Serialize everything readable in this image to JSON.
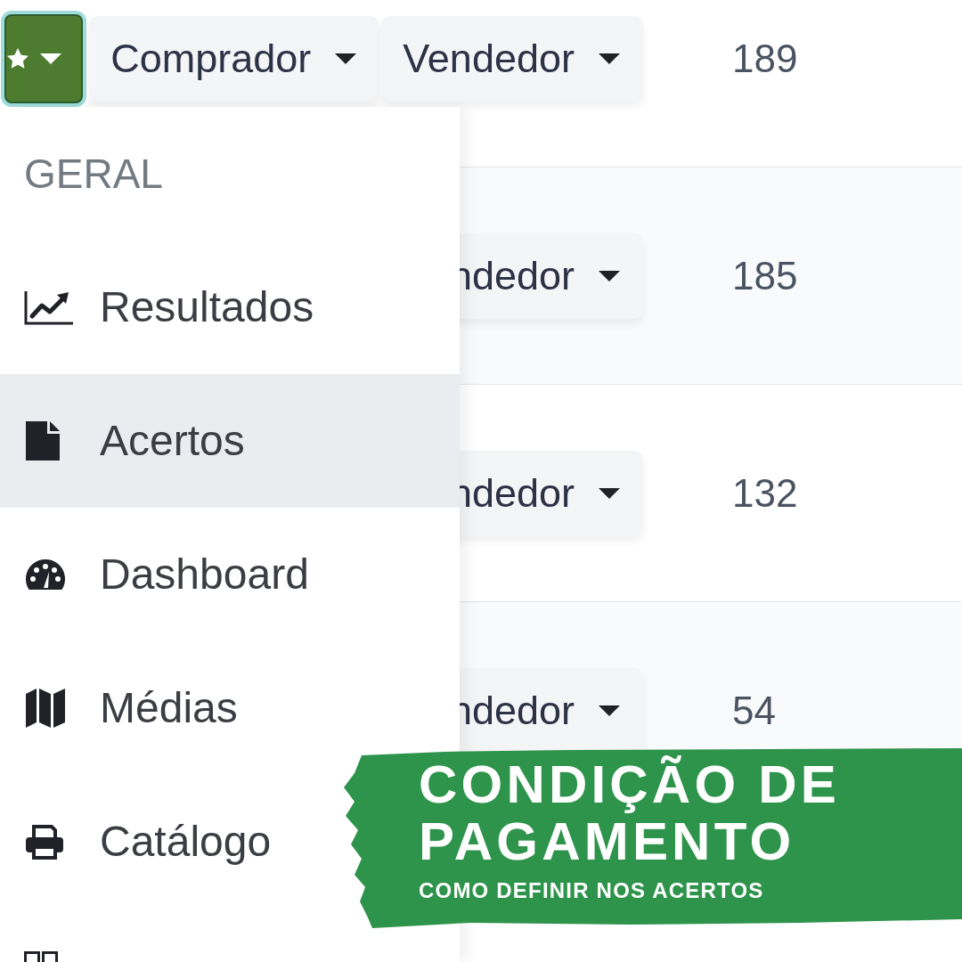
{
  "table": {
    "rows": [
      {
        "actions": [
          {
            "kind": "icon_menu",
            "focused": true
          },
          {
            "kind": "dropdown",
            "label": "Comprador",
            "focused": false
          },
          {
            "kind": "dropdown",
            "label": "Vendedor",
            "focused": false
          }
        ],
        "count": "189"
      },
      {
        "actions": [
          {
            "kind": "dropdown",
            "label": "ndedor",
            "focused": false
          }
        ],
        "count": "185"
      },
      {
        "actions": [
          {
            "kind": "dropdown",
            "label": "ndedor",
            "focused": false
          }
        ],
        "count": "132"
      },
      {
        "actions": [
          {
            "kind": "dropdown",
            "label": "ndedor",
            "focused": false
          }
        ],
        "count": "54"
      }
    ]
  },
  "menu": {
    "header": "GERAL",
    "items": [
      {
        "label": "Resultados",
        "selected": false
      },
      {
        "label": "Acertos",
        "selected": true
      },
      {
        "label": "Dashboard",
        "selected": false
      },
      {
        "label": "Médias",
        "selected": false
      },
      {
        "label": "Catálogo",
        "selected": false
      },
      {
        "selected": false
      }
    ]
  },
  "banner": {
    "title": "CONDIÇÃO DE PAGAMENTO",
    "subtitle": "COMO DEFINIR NOS ACERTOS"
  }
}
